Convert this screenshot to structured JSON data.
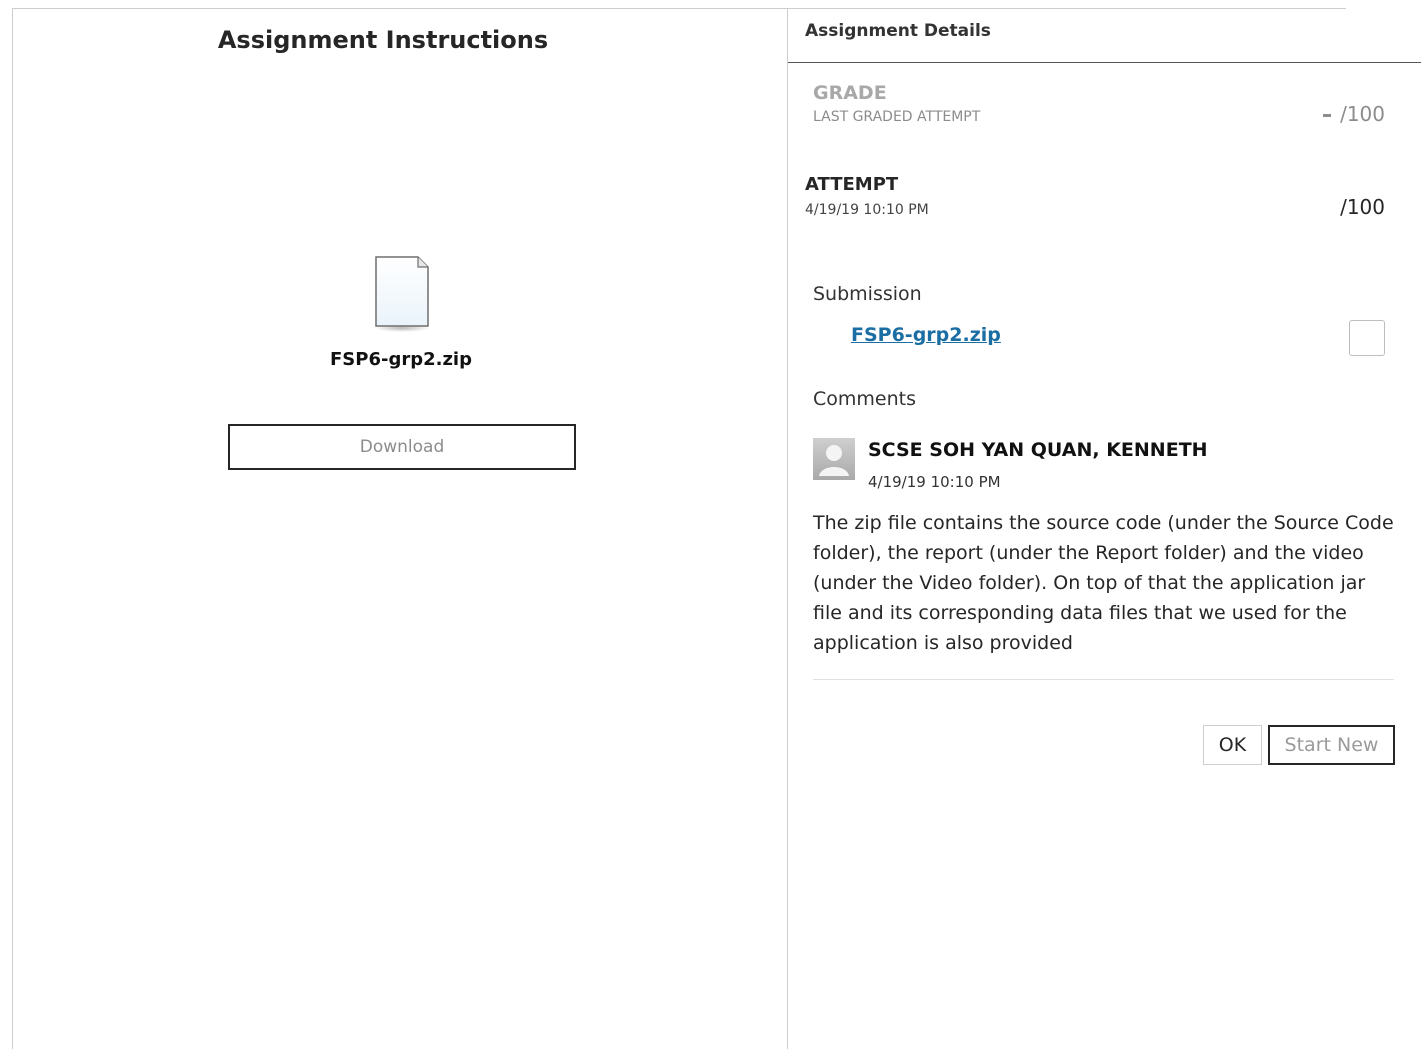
{
  "instructions": {
    "title": "Assignment Instructions",
    "file_icon": "document-icon",
    "file_name": "FSP6-grp2.zip",
    "download_label": "Download"
  },
  "details": {
    "title": "Assignment Details",
    "grade": {
      "label": "GRADE",
      "sublabel": "LAST GRADED ATTEMPT",
      "value": "/100"
    },
    "attempt": {
      "label": "ATTEMPT",
      "date": "4/19/19 10:10 PM",
      "value": "/100"
    },
    "submission": {
      "label": "Submission",
      "file_link": "FSP6-grp2.zip"
    },
    "comments": {
      "label": "Comments",
      "author": "SCSE SOH YAN QUAN, KENNETH",
      "date": "4/19/19 10:10 PM",
      "text": "The zip file contains the source code (under the Source Code folder), the report (under the Report folder) and the video (under the Video folder). On top of that the application jar file and its corresponding data files that we used for the application is also provided"
    },
    "actions": {
      "ok_label": "OK",
      "start_new_label": "Start New"
    }
  },
  "colors": {
    "link": "#1a6ea3",
    "text": "#262626",
    "muted": "#8c8c8c"
  }
}
